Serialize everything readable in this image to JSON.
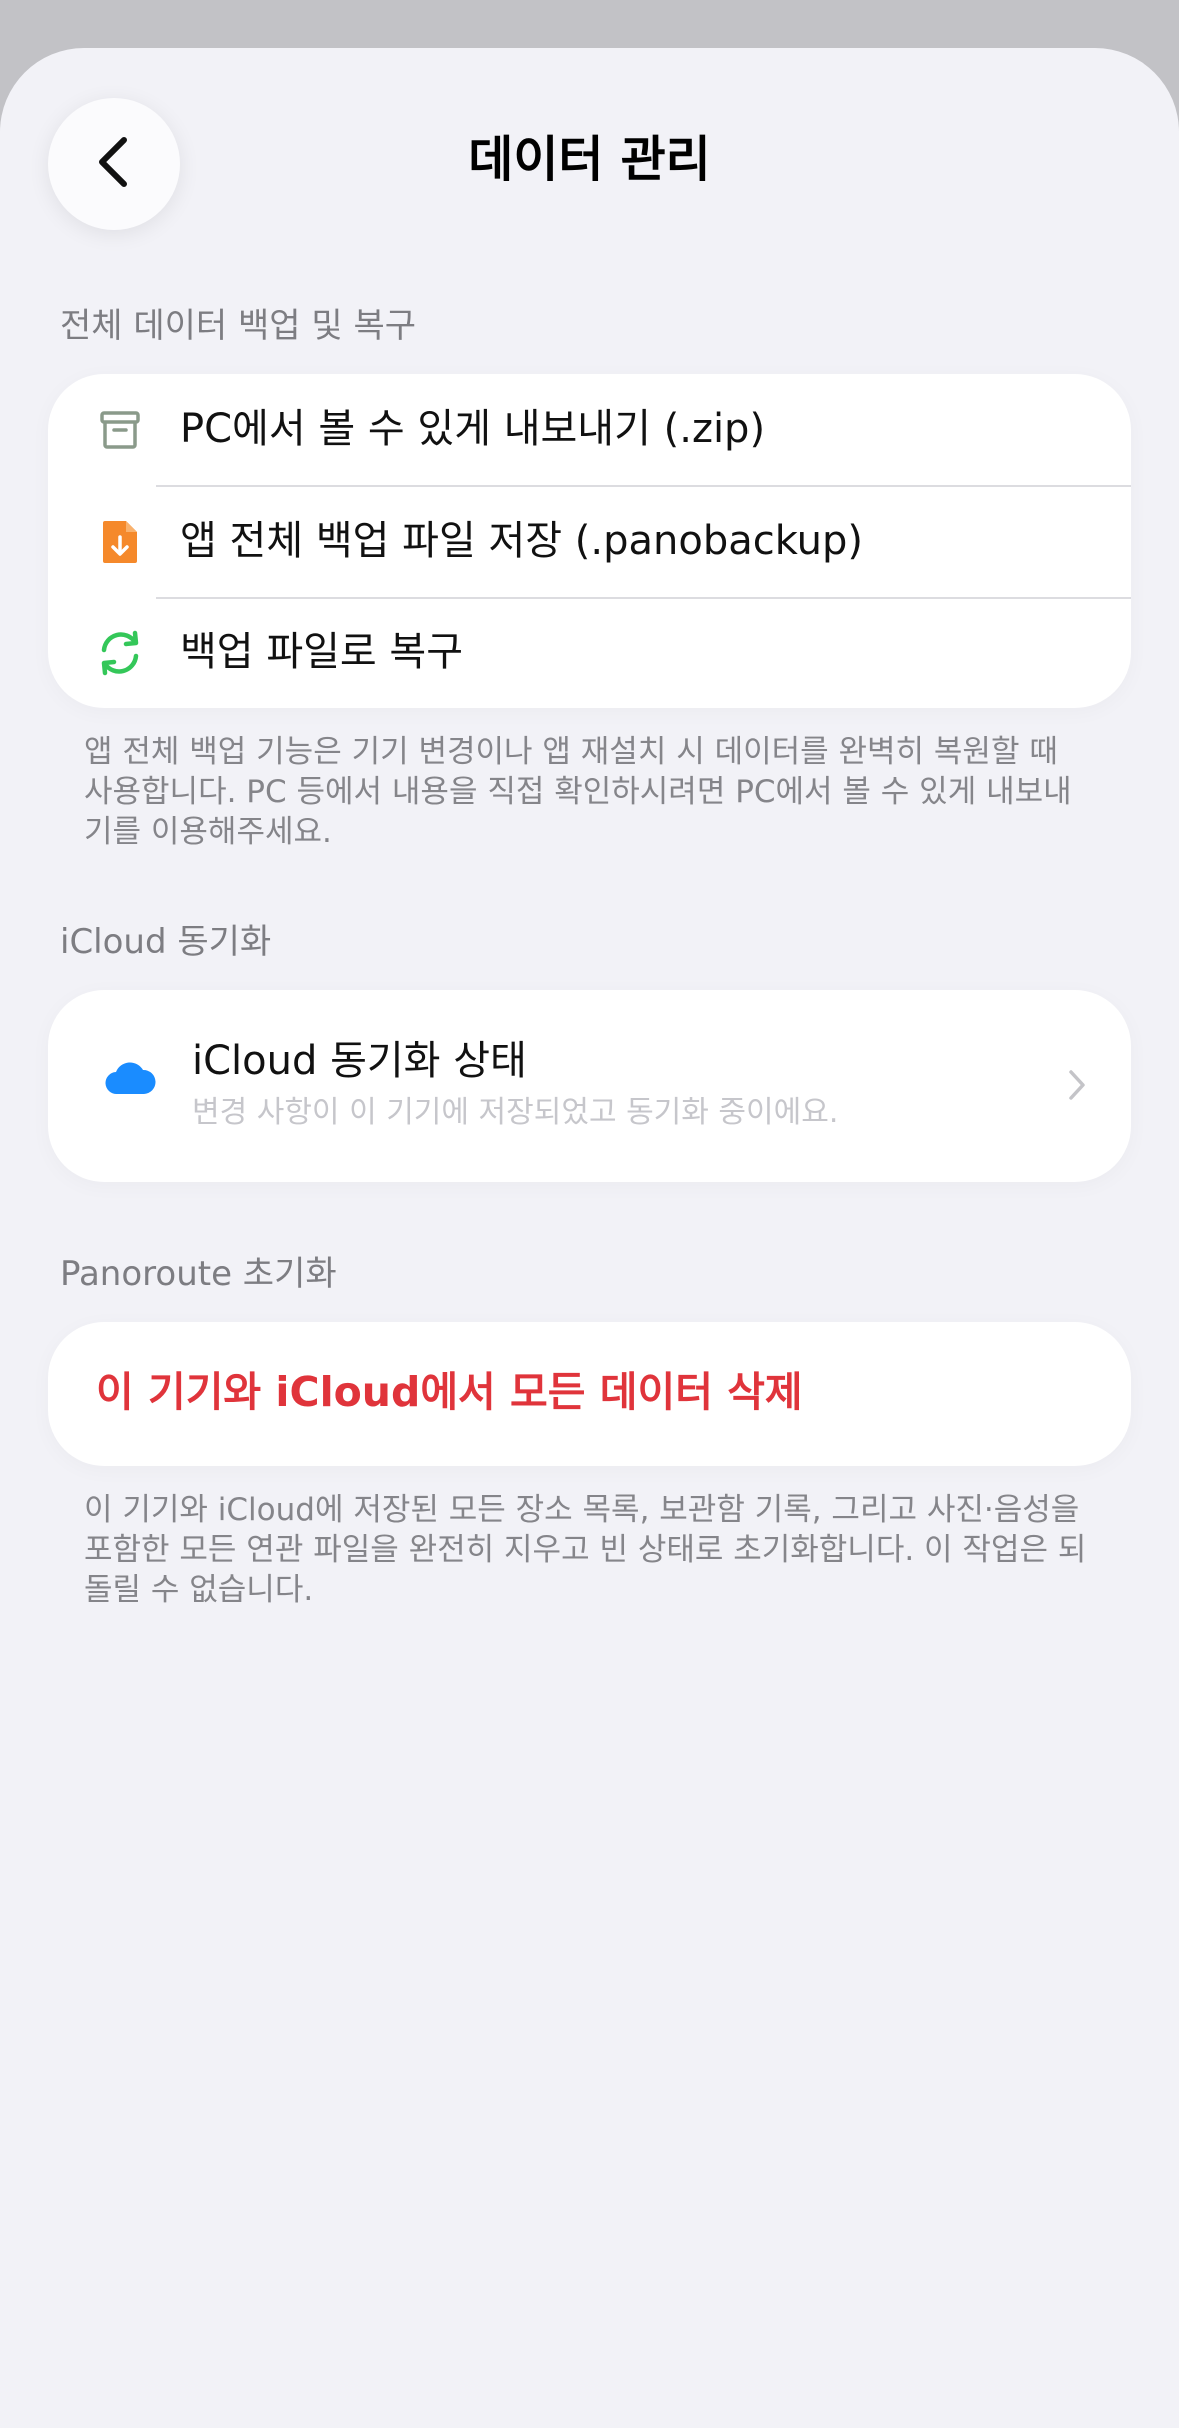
{
  "header": {
    "title": "데이터 관리"
  },
  "backup_section": {
    "header": "전체 데이터 백업 및 복구",
    "items": [
      {
        "label": "PC에서 볼 수 있게 내보내기 (.zip)",
        "icon": "archive-box-icon"
      },
      {
        "label": "앱 전체 백업 파일 저장 (.panobackup)",
        "icon": "document-download-icon"
      },
      {
        "label": "백업 파일로 복구",
        "icon": "refresh-arrows-icon"
      }
    ],
    "footnote": "앱 전체 백업 기능은 기기 변경이나 앱 재설치 시 데이터를 완벽히 복원할 때 사용합니다. PC 등에서 내용을 직접 확인하시려면 PC에서 볼 수 있게 내보내기를 이용해주세요."
  },
  "icloud_section": {
    "header": "iCloud 동기화",
    "status_title": "iCloud 동기화 상태",
    "status_subtitle": "변경 사항이 이 기기에 저장되었고 동기화 중이에요."
  },
  "reset_section": {
    "header": "Panoroute 초기화",
    "delete_label": "이 기기와 iCloud에서 모든 데이터 삭제",
    "footnote": "이 기기와 iCloud에 저장된 모든 장소 목록, 보관함 기록, 그리고 사진·음성을 포함한 모든 연관 파일을 완전히 지우고 빈 상태로 초기화합니다. 이 작업은 되돌릴 수 없습니다."
  },
  "colors": {
    "accent_red": "#e0343b",
    "icon_orange": "#f5892b",
    "icon_green": "#34c759",
    "icon_blue": "#1a8cff",
    "icon_gray_green": "#8a9a8a"
  }
}
